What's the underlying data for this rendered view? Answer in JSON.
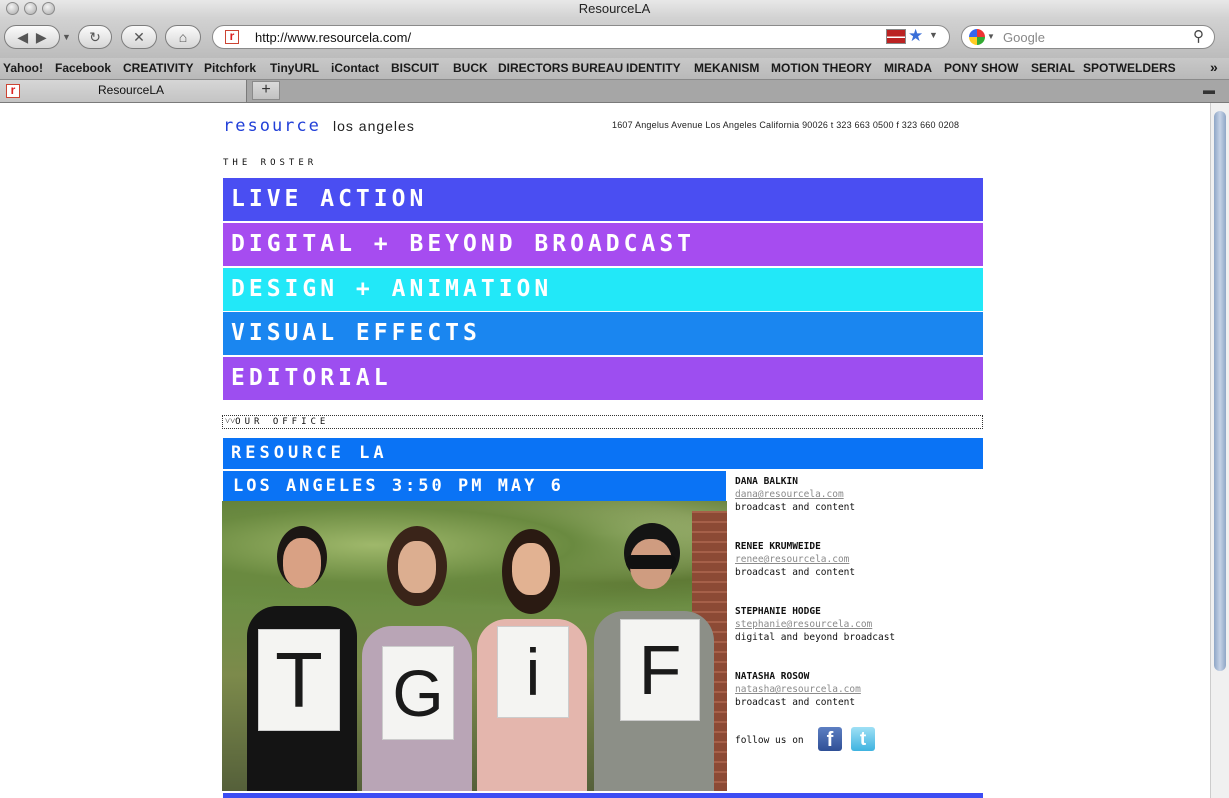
{
  "browser": {
    "window_title": "ResourceLA",
    "url": "http://www.resourcela.com/",
    "search_placeholder": "Google",
    "tab_title": "ResourceLA",
    "new_tab_label": "+",
    "bookmarks": [
      "Yahoo!",
      "Facebook",
      "CREATIVITY",
      "Pitchfork",
      "TinyURL",
      "iContact",
      "BISCUIT",
      "BUCK",
      "DIRECTORS BUREAU",
      "IDENTITY",
      "MEKANISM",
      "MOTION THEORY",
      "MIRADA",
      "PONY SHOW",
      "SERIAL",
      "SPOTWELDERS"
    ],
    "overflow_label": "»"
  },
  "site": {
    "logo_main": "resource",
    "logo_sub": "los angeles",
    "address": "1607 Angelus Avenue Los Angeles California 90026 t 323 663 0500 f 323 660 0208",
    "roster_label": "THE ROSTER",
    "roster": [
      {
        "label": "LIVE ACTION",
        "color": "#4a4ef2"
      },
      {
        "label": "DIGITAL + BEYOND BROADCAST",
        "color": "#a64cf0"
      },
      {
        "label": "DESIGN + ANIMATION",
        "color": "#22e8f8"
      },
      {
        "label": "VISUAL EFFECTS",
        "color": "#1a86f0"
      },
      {
        "label": "EDITORIAL",
        "color": "#9d4ef0"
      }
    ],
    "office_label": "OUR OFFICE",
    "office_toggle": "˅˅",
    "office_name": "RESOURCE LA",
    "local_time": "LOS ANGELES 3:50 PM MAY 6",
    "photo_letters": [
      "T",
      "G",
      "i",
      "F"
    ],
    "contacts": [
      {
        "name": "DANA BALKIN",
        "email": "dana@resourcela.com",
        "role": "broadcast and content"
      },
      {
        "name": "RENEE KRUMWEIDE",
        "email": "renee@resourcela.com",
        "role": "broadcast and content"
      },
      {
        "name": "STEPHANIE HODGE",
        "email": "stephanie@resourcela.com",
        "role": "digital and beyond broadcast"
      },
      {
        "name": "NATASHA ROSOW",
        "email": "natasha@resourcela.com",
        "role": "broadcast and content"
      }
    ],
    "follow_label": "follow us on",
    "social": [
      "f",
      "t"
    ]
  }
}
